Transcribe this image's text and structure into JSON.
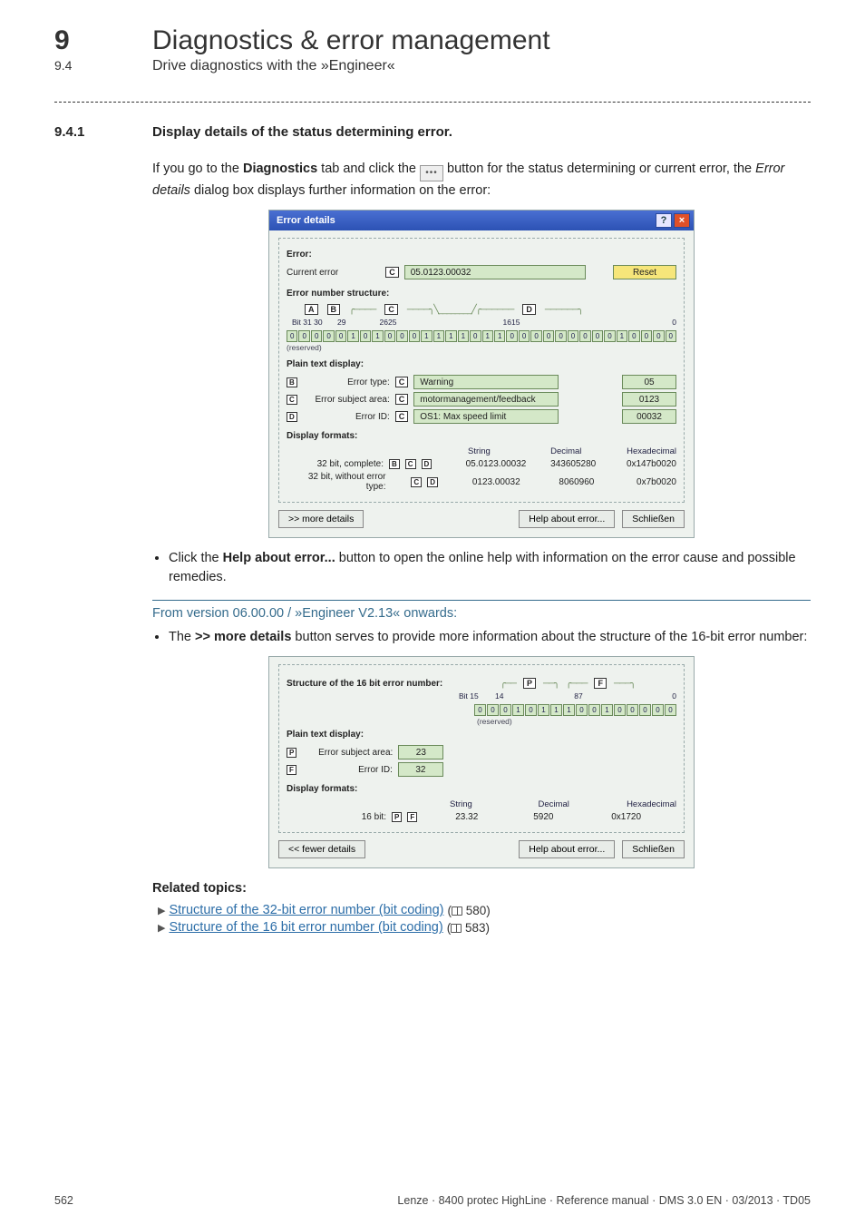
{
  "header": {
    "chapter_number": "9",
    "chapter_title": "Diagnostics & error management",
    "section_number": "9.4",
    "section_title": "Drive diagnostics with the »Engineer«"
  },
  "section": {
    "number": "9.4.1",
    "title": "Display details of the status determining error."
  },
  "intro": {
    "pre": "If you go to the ",
    "diagnostics": "Diagnostics",
    "mid": " tab and click the ",
    "post": " button for the status determining or current error, the ",
    "dialog_name": "Error details",
    "tail": " dialog box displays further information on the error:"
  },
  "dialog1": {
    "title": "Error details",
    "group_error": "Error:",
    "current_error_label": "Current error",
    "tag_c": "C",
    "current_error_value": "05.0123.00032",
    "reset": "Reset",
    "structure_title": "Error number structure:",
    "tag_a": "A",
    "tag_b": "B",
    "tag_d": "D",
    "bit_hi": "Bit 31 30",
    "bit_29": "29",
    "bit_26": "26",
    "bit_25": "25",
    "bit_16": "16",
    "bit_15": "15",
    "bit_0": "0",
    "bits": [
      "0",
      "0",
      "0",
      "0",
      "0",
      "1",
      "0",
      "1",
      "0",
      "0",
      "0",
      "1",
      "1",
      "1",
      "1",
      "0",
      "1",
      "1",
      "0",
      "0",
      "0",
      "0",
      "0",
      "0",
      "0",
      "0",
      "0",
      "1",
      "0",
      "0",
      "0",
      "0"
    ],
    "reserved": "(reserved)",
    "plain_title": "Plain text display:",
    "error_type_label": "Error type:",
    "error_type_value": "Warning",
    "error_type_code": "05",
    "error_subject_label": "Error subject area:",
    "error_subject_value": "motormanagement/feedback",
    "error_subject_code": "0123",
    "error_id_label": "Error ID:",
    "error_id_value": "OS1: Max speed limit",
    "error_id_code": "00032",
    "display_title": "Display formats:",
    "col_string": "String",
    "col_decimal": "Decimal",
    "col_hex": "Hexadecimal",
    "row1_label": "32 bit, complete:",
    "row1_string": "05.0123.00032",
    "row1_dec": "343605280",
    "row1_hex": "0x147b0020",
    "row2_label": "32 bit, without error type:",
    "row2_string": "0123.00032",
    "row2_dec": "8060960",
    "row2_hex": "0x7b0020",
    "more": ">> more details",
    "help": "Help about error...",
    "close": "Schließen"
  },
  "bullet1": {
    "pre": "Click the ",
    "bold": "Help about error...",
    "post": " button to open the online help with information on the error cause and possible remedies."
  },
  "note": "From version  06.00.00 / »Engineer V2.13« onwards:",
  "bullet2": {
    "pre": "The ",
    "bold": ">> more details",
    "post": " button serves to provide more information about the structure of the 16-bit error number:"
  },
  "dialog2": {
    "structure_title": "Structure of the 16 bit error number:",
    "tag_p": "P",
    "tag_f": "F",
    "bit_15": "Bit 15",
    "bit_14": "14",
    "bit_8": "8",
    "bit_7": "7",
    "bit_0": "0",
    "bits16": [
      "0",
      "0",
      "0",
      "1",
      "0",
      "1",
      "1",
      "1",
      "0",
      "0",
      "1",
      "0",
      "0",
      "0",
      "0",
      "0"
    ],
    "reserved": "(reserved)",
    "plain_title": "Plain text display:",
    "error_subject_label": "Error subject area:",
    "error_subject_value": "23",
    "error_id_label": "Error ID:",
    "error_id_value": "32",
    "display_title": "Display formats:",
    "col_string": "String",
    "col_decimal": "Decimal",
    "col_hex": "Hexadecimal",
    "row_label": "16 bit:",
    "row_string": "23.32",
    "row_dec": "5920",
    "row_hex": "0x1720",
    "fewer": "<< fewer details",
    "help": "Help about error...",
    "close": "Schließen"
  },
  "related": {
    "title": "Related topics:",
    "link1": "Structure of the 32-bit error number (bit coding)",
    "link1_page": "580",
    "link2": "Structure of the 16 bit error number (bit coding)",
    "link2_page": "583"
  },
  "footer": {
    "page": "562",
    "text": "Lenze · 8400 protec HighLine · Reference manual · DMS 3.0 EN · 03/2013 · TD05"
  }
}
